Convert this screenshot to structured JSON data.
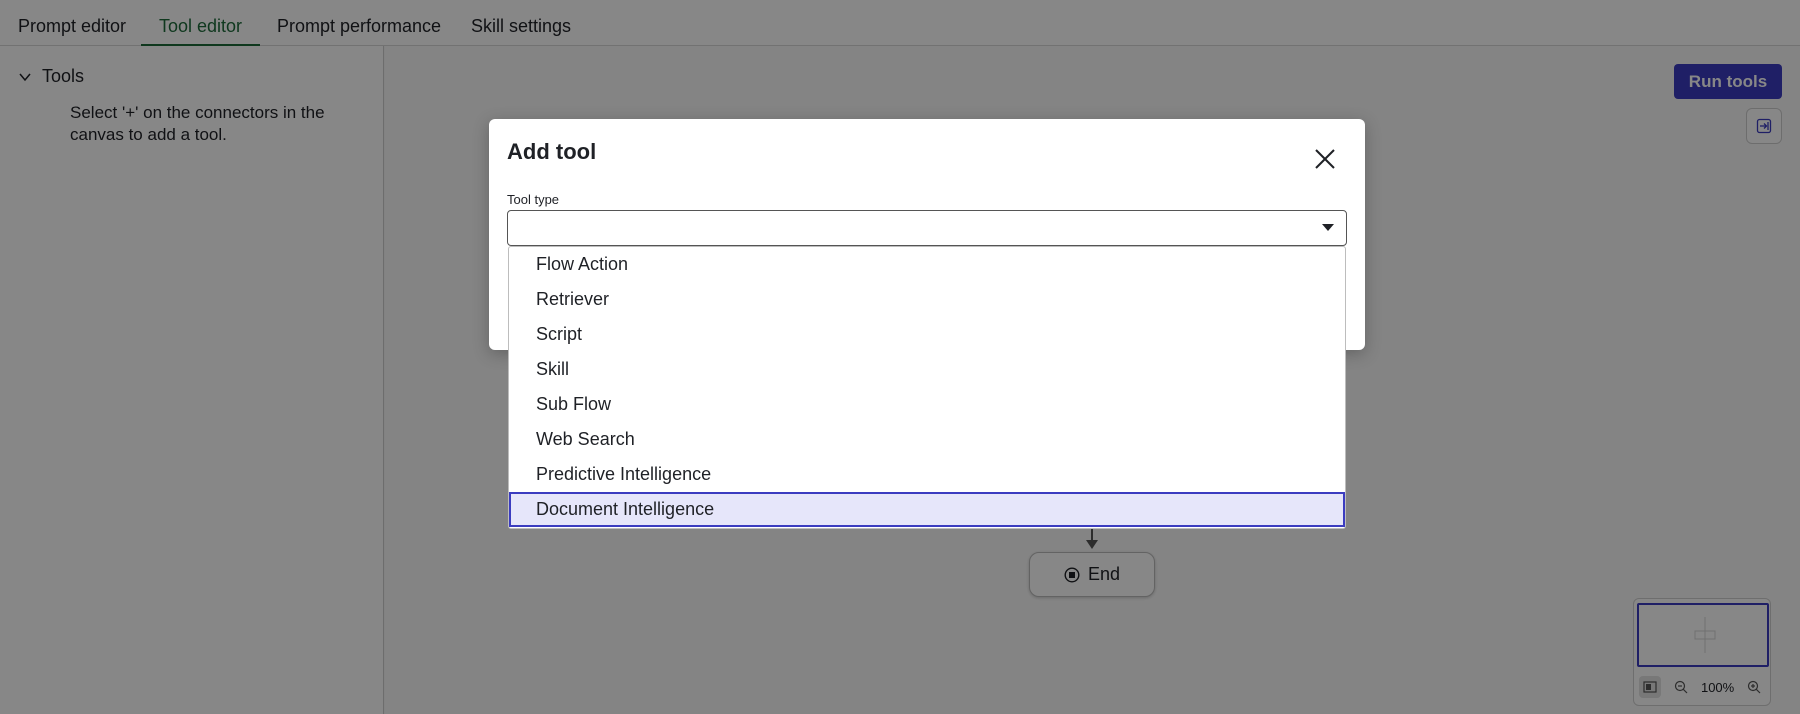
{
  "tabs": [
    {
      "label": "Prompt editor"
    },
    {
      "label": "Tool editor"
    },
    {
      "label": "Prompt performance"
    },
    {
      "label": "Skill settings"
    }
  ],
  "active_tab": "Tool editor",
  "sidebar": {
    "tree_label": "Tools",
    "hint": "Select '+' on the connectors in the canvas to add a tool."
  },
  "canvas": {
    "run_button": "Run tools",
    "end_node": "End",
    "zoom": "100%"
  },
  "modal": {
    "title": "Add tool",
    "field_label": "Tool type",
    "select_value": "",
    "options": [
      "Flow Action",
      "Retriever",
      "Script",
      "Skill",
      "Sub Flow",
      "Web Search",
      "Predictive Intelligence",
      "Document Intelligence"
    ],
    "highlighted_option": "Document Intelligence"
  },
  "colors": {
    "accent": "#3b3cc0",
    "active_tab": "#1d6b3a",
    "highlight_bg": "#e6e6fa"
  }
}
